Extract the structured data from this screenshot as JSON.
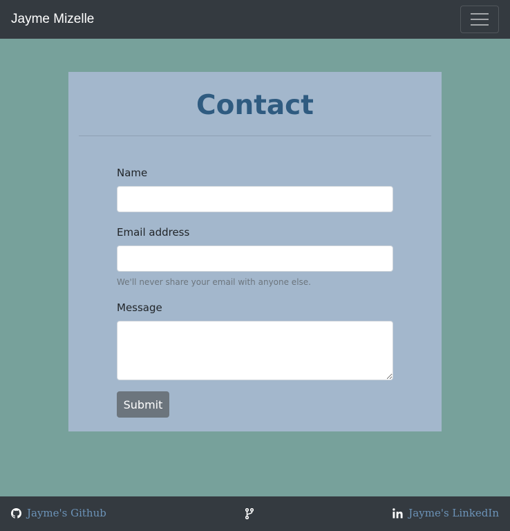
{
  "navbar": {
    "brand": "Jayme Mizelle",
    "menu_icon": "hamburger-icon"
  },
  "contact": {
    "title": "Contact",
    "name_label": "Name",
    "name_value": "",
    "email_label": "Email address",
    "email_value": "",
    "email_help": "We'll never share your email with anyone else.",
    "message_label": "Message",
    "message_value": "",
    "submit_label": "Submit"
  },
  "footer": {
    "github_label": "Jayme's Github",
    "github_icon": "github-icon",
    "fork_icon": "code-fork-icon",
    "linkedin_label": "Jayme's LinkedIn",
    "linkedin_icon": "linkedin-icon"
  },
  "colors": {
    "navbar_bg": "#343a40",
    "page_bg": "#77a19b",
    "card_bg": "#a3b7cc",
    "title": "#2f5b80",
    "button_bg": "#6c757d",
    "footer_link": "#6c93b8"
  }
}
